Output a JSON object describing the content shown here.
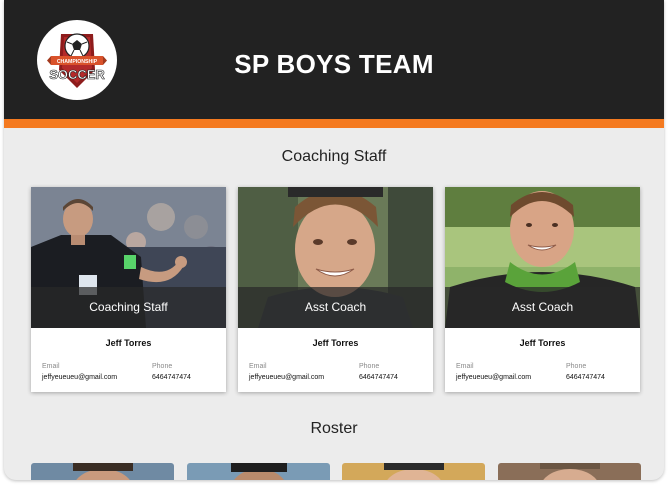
{
  "header": {
    "title": "SP BOYS TEAM",
    "logo": {
      "icon": "soccer-ball-shield-icon",
      "ribbon_text": "CHAMPIONSHIP",
      "wordmark": "SOCCER"
    }
  },
  "colors": {
    "header_bg": "#222222",
    "accent": "#f47a20",
    "page_bg": "#ececec"
  },
  "sections": {
    "coaching_title": "Coaching Staff",
    "roster_title": "Roster"
  },
  "staff": [
    {
      "role": "Coaching Staff",
      "name": "Jeff Torres",
      "email_label": "Email",
      "email": "jeffyeueueu@gmail.com",
      "phone_label": "Phone",
      "phone": "6464747474"
    },
    {
      "role": "Asst Coach",
      "name": "Jeff Torres",
      "email_label": "Email",
      "email": "jeffyeueueu@gmail.com",
      "phone_label": "Phone",
      "phone": "6464747474"
    },
    {
      "role": "Asst Coach",
      "name": "Jeff Torres",
      "email_label": "Email",
      "email": "jeffyeueueu@gmail.com",
      "phone_label": "Phone",
      "phone": "6464747474"
    }
  ]
}
